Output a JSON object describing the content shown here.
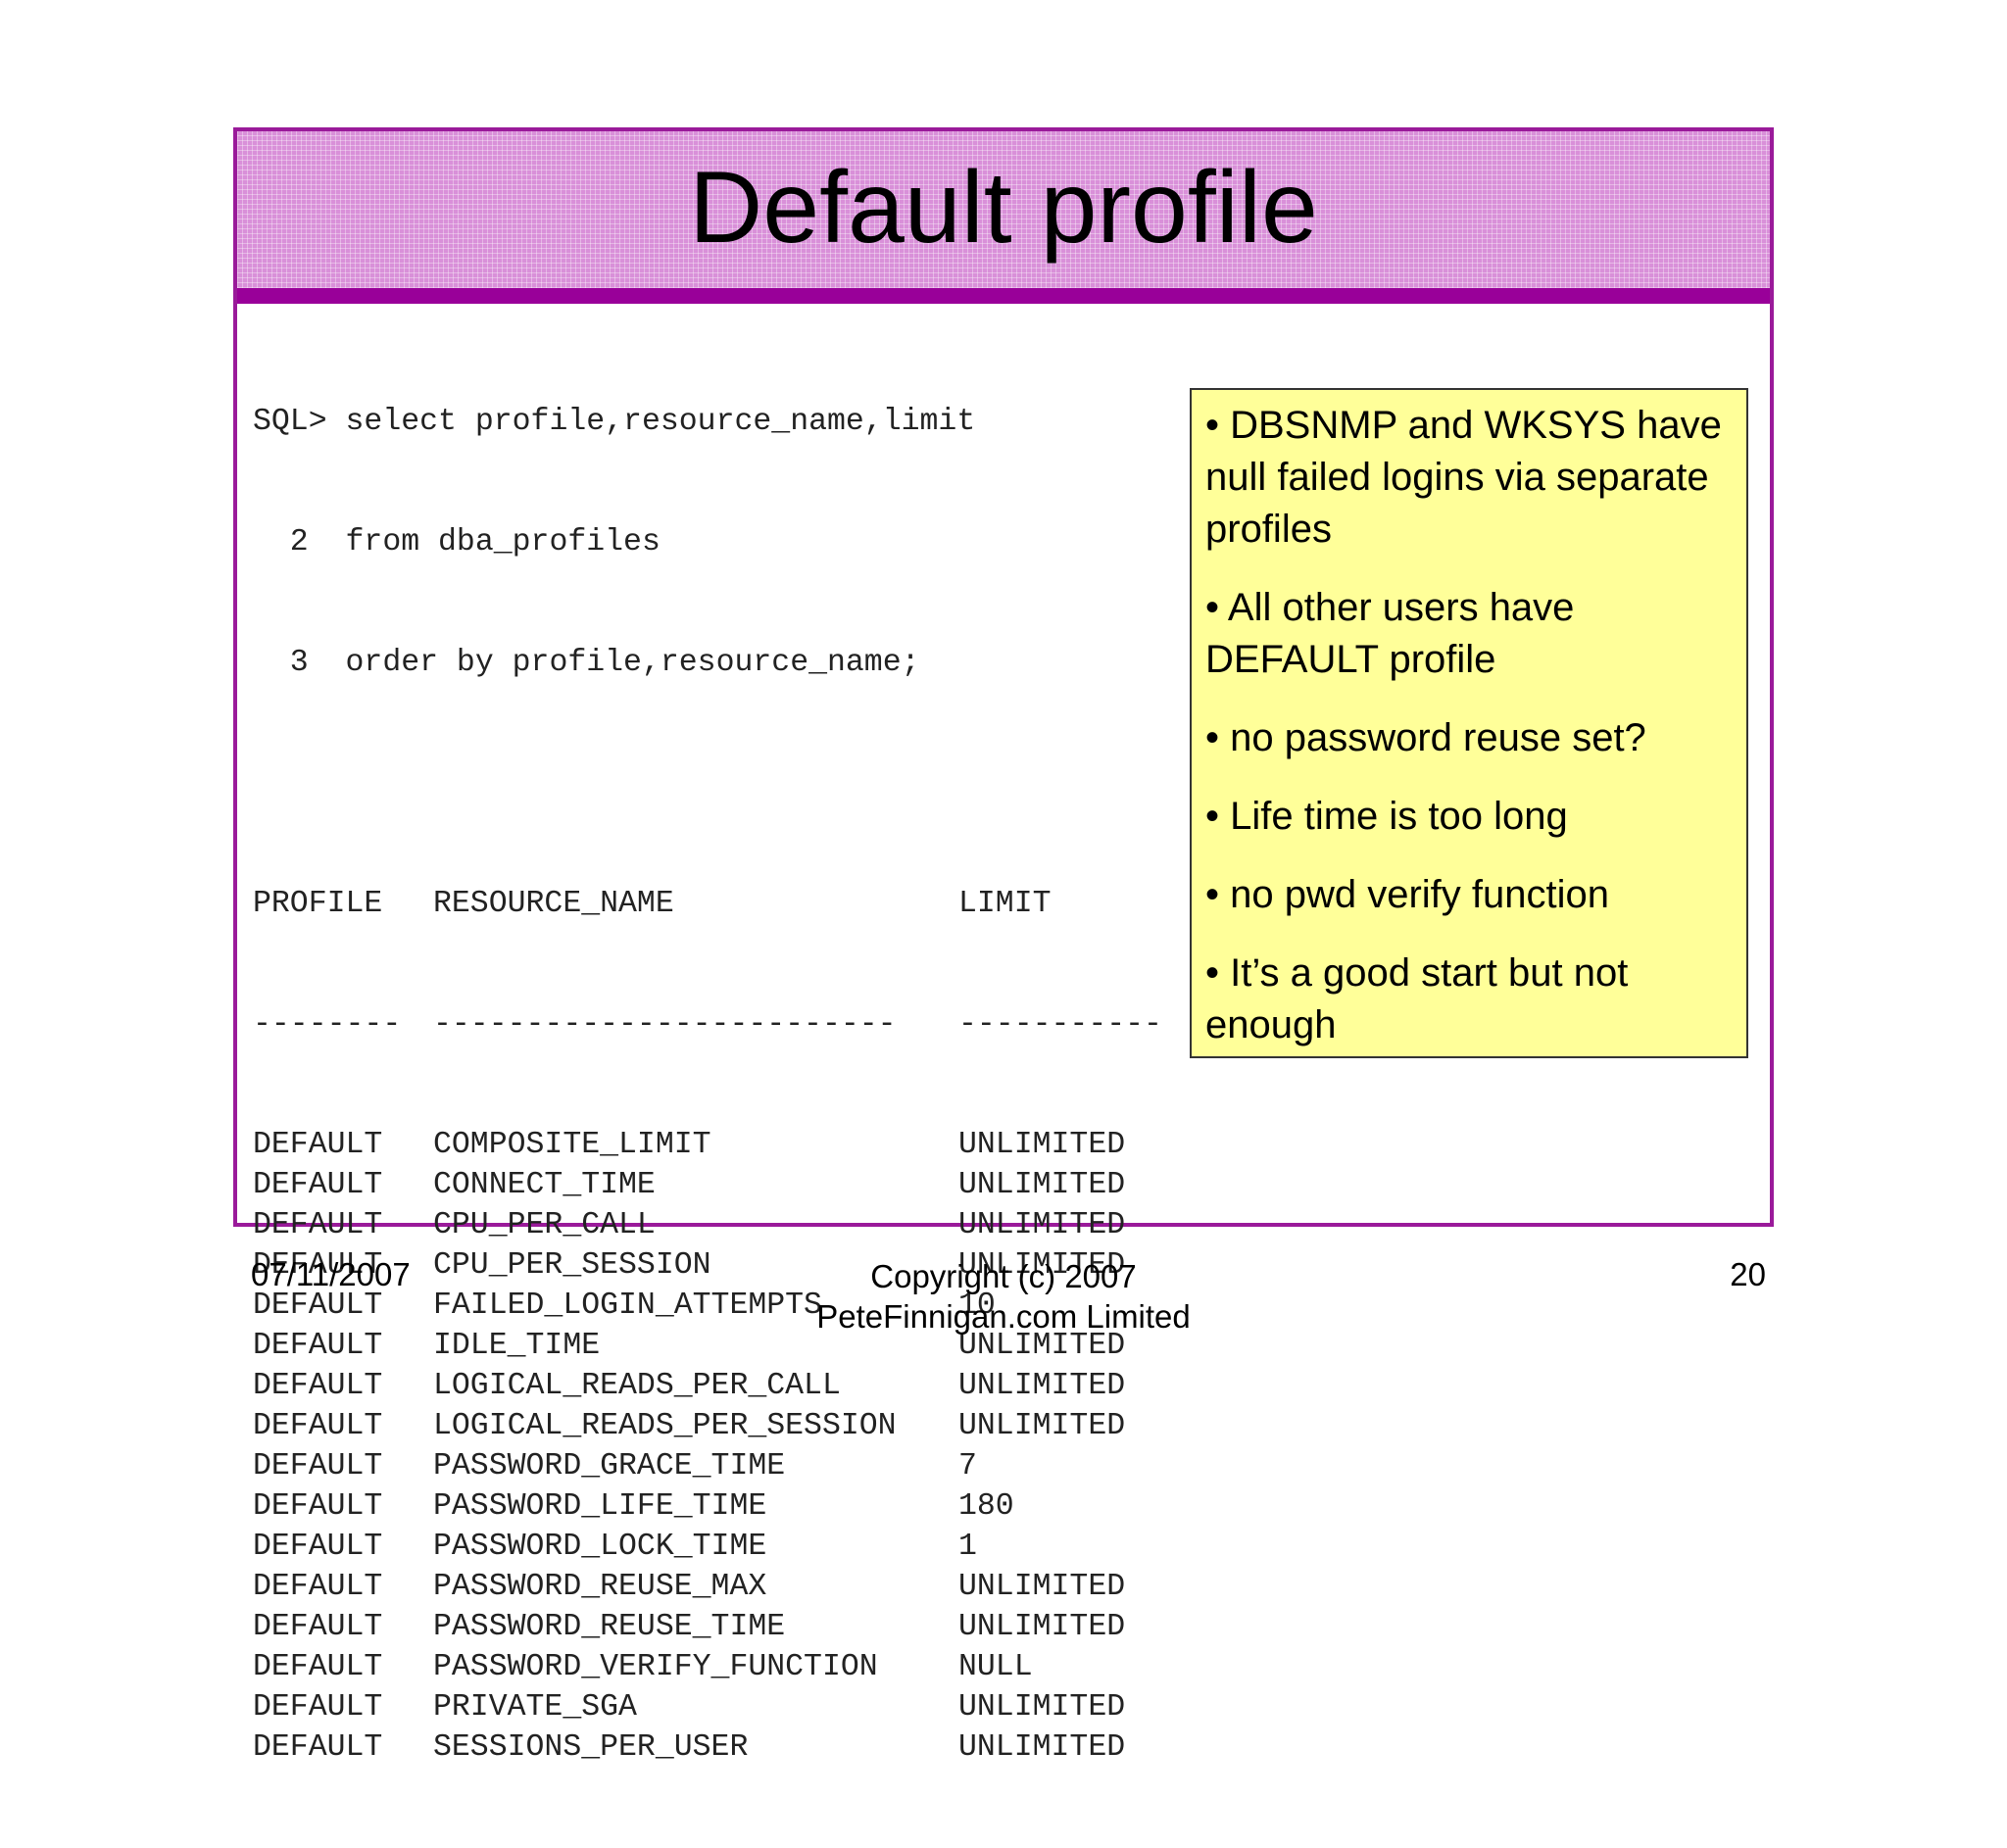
{
  "slide": {
    "title": "Default profile"
  },
  "sql": {
    "lines": [
      "SQL> select profile,resource_name,limit",
      "  2  from dba_profiles",
      "  3  order by profile,resource_name;"
    ]
  },
  "table": {
    "headers": [
      "PROFILE",
      "RESOURCE_NAME",
      "LIMIT"
    ],
    "dashes": [
      "--------",
      "-------------------------",
      "-----------"
    ],
    "rows": [
      [
        "DEFAULT",
        "COMPOSITE_LIMIT",
        "UNLIMITED"
      ],
      [
        "DEFAULT",
        "CONNECT_TIME",
        "UNLIMITED"
      ],
      [
        "DEFAULT",
        "CPU_PER_CALL",
        "UNLIMITED"
      ],
      [
        "DEFAULT",
        "CPU_PER_SESSION",
        "UNLIMITED"
      ],
      [
        "DEFAULT",
        "FAILED_LOGIN_ATTEMPTS",
        "10"
      ],
      [
        "DEFAULT",
        "IDLE_TIME",
        "UNLIMITED"
      ],
      [
        "DEFAULT",
        "LOGICAL_READS_PER_CALL",
        "UNLIMITED"
      ],
      [
        "DEFAULT",
        "LOGICAL_READS_PER_SESSION",
        "UNLIMITED"
      ],
      [
        "DEFAULT",
        "PASSWORD_GRACE_TIME",
        "7"
      ],
      [
        "DEFAULT",
        "PASSWORD_LIFE_TIME",
        "180"
      ],
      [
        "DEFAULT",
        "PASSWORD_LOCK_TIME",
        "1"
      ],
      [
        "DEFAULT",
        "PASSWORD_REUSE_MAX",
        "UNLIMITED"
      ],
      [
        "DEFAULT",
        "PASSWORD_REUSE_TIME",
        "UNLIMITED"
      ],
      [
        "DEFAULT",
        "PASSWORD_VERIFY_FUNCTION",
        "NULL"
      ],
      [
        "DEFAULT",
        "PRIVATE_SGA",
        "UNLIMITED"
      ],
      [
        "DEFAULT",
        "SESSIONS_PER_USER",
        "UNLIMITED"
      ]
    ]
  },
  "notes": [
    "• DBSNMP and WKSYS have null failed logins via separate profiles",
    "• All other users have DEFAULT profile",
    "• no password reuse set?",
    "• Life time is too long",
    "• no pwd verify function",
    "• It’s a good start but not enough"
  ],
  "footer": {
    "date": "07/11/2007",
    "copyright_line1": "Copyright (c) 2007",
    "copyright_line2": "PeteFinnigan.com Limited",
    "page_number": "20"
  },
  "colors": {
    "frame": "#9a1a9a",
    "title_band": "#d990d9",
    "note_background": "#ffff99"
  }
}
